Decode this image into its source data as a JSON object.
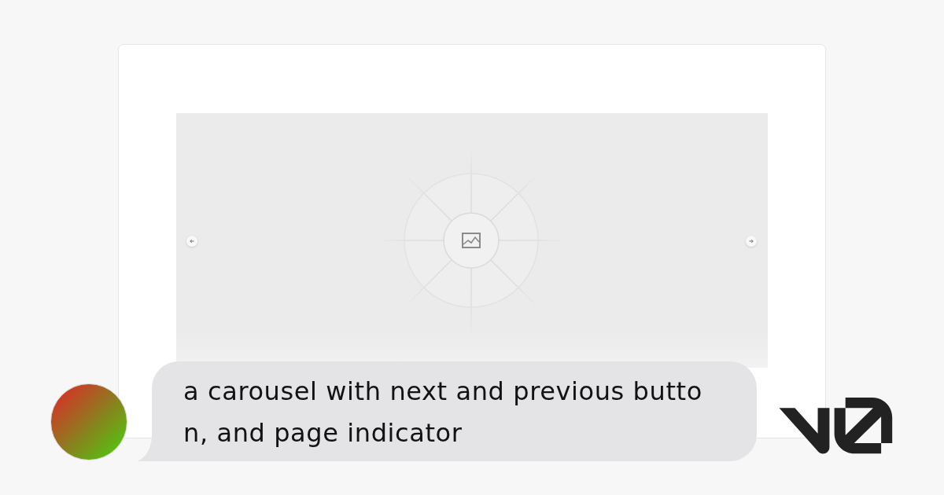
{
  "prompt": {
    "lines": [
      "a carousel with next and previous butto",
      "n, and page indicator"
    ]
  }
}
